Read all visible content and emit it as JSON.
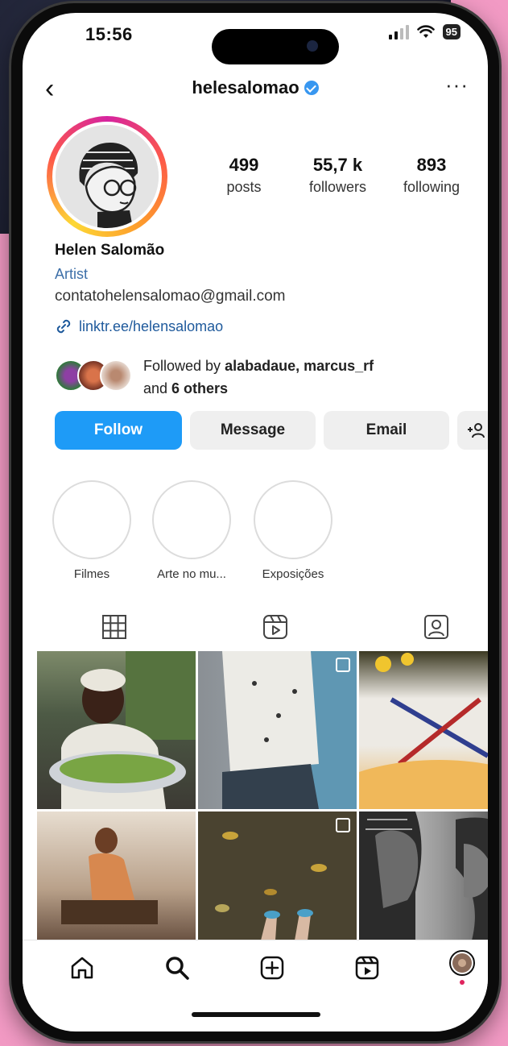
{
  "status": {
    "time": "15:56",
    "battery": "95"
  },
  "header": {
    "username": "helesalomao",
    "more": "···"
  },
  "stats": [
    {
      "num": "499",
      "label": "posts"
    },
    {
      "num": "55,7 k",
      "label": "followers"
    },
    {
      "num": "893",
      "label": "following"
    }
  ],
  "bio": {
    "name": "Helen Salomão",
    "category": "Artist",
    "email": "contatohelensalomao@gmail.com",
    "link": "linktr.ee/helensalomao"
  },
  "followed": {
    "prefix": "Followed by ",
    "names": "alabadaue, marcus_rf",
    "and": "and ",
    "others": "6 others"
  },
  "buttons": {
    "follow": "Follow",
    "message": "Message",
    "email": "Email"
  },
  "highlights": [
    "Filmes",
    "Arte no mu...",
    "Exposições"
  ],
  "colors": {
    "accent": "#1e9bf7",
    "link": "#1f5a9c",
    "category": "#3d6fa8"
  }
}
